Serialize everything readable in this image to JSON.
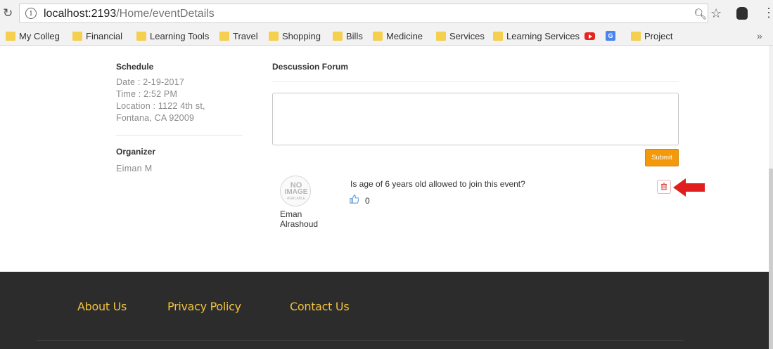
{
  "browser": {
    "url_host": "localhost:2193",
    "url_path": "/Home/eventDetails"
  },
  "bookmarks": [
    {
      "label": "My Colleg"
    },
    {
      "label": "Financial"
    },
    {
      "label": "Learning Tools"
    },
    {
      "label": "Travel"
    },
    {
      "label": "Shopping"
    },
    {
      "label": "Bills"
    },
    {
      "label": "Medicine"
    },
    {
      "label": "Services"
    },
    {
      "label": "Learning Services"
    },
    {
      "label": "Project"
    }
  ],
  "schedule": {
    "heading": "Schedule",
    "date": "Date : 2-19-2017",
    "time": "Time : 2:52 PM",
    "location_1": "Location : 1122 4th st,",
    "location_2": "Fontana, CA 92009"
  },
  "organizer": {
    "heading": "Organizer",
    "name": "Eiman M"
  },
  "forum": {
    "heading": "Descussion Forum",
    "comment_value": "",
    "submit_label": "Submit",
    "post": {
      "avatar_text": [
        "NO",
        "IMAGE",
        "AVAILABLE"
      ],
      "author_first": "Eman",
      "author_last": "Alrashoud",
      "question": "Is age of 6 years old allowed to join this event?",
      "likes": "0"
    }
  },
  "footer": {
    "links": [
      "About Us",
      "Privacy Policy",
      "Contact Us"
    ]
  },
  "colors": {
    "submit": "#f39a0c",
    "footer_bg": "#2c2c2c",
    "footer_link": "#f2c23a",
    "delete_icon": "#d9534f",
    "arrow": "#e01e1e"
  }
}
